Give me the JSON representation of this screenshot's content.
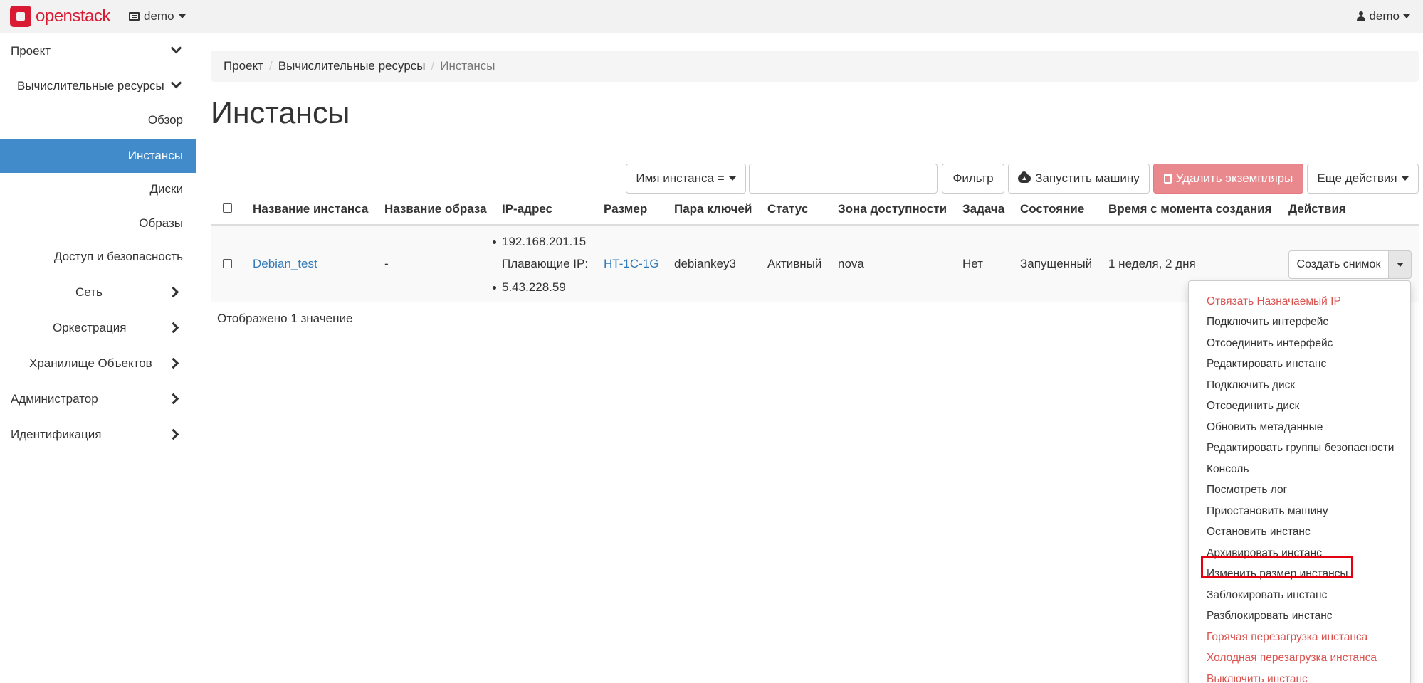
{
  "navbar": {
    "brand": "openstack",
    "project": "demo",
    "user": "demo"
  },
  "sidebar": {
    "items": [
      {
        "label": "Проект",
        "level": 0,
        "chevron": "down"
      },
      {
        "label": "Вычислительные ресурсы",
        "level": 1,
        "chevron": "down"
      },
      {
        "label": "Обзор",
        "level": 2
      },
      {
        "label": "Инстансы",
        "level": 2,
        "active": true
      },
      {
        "label": "Диски",
        "level": 2
      },
      {
        "label": "Образы",
        "level": 2
      },
      {
        "label": "Доступ и безопасность",
        "level": 2
      },
      {
        "label": "Сеть",
        "level": 1,
        "chevron": "right"
      },
      {
        "label": "Оркестрация",
        "level": 1,
        "chevron": "right"
      },
      {
        "label": "Хранилище Объектов",
        "level": 1,
        "chevron": "right"
      },
      {
        "label": "Администратор",
        "level": 0,
        "chevron": "right"
      },
      {
        "label": "Идентификация",
        "level": 0,
        "chevron": "right"
      }
    ]
  },
  "breadcrumb": [
    "Проект",
    "Вычислительные ресурсы",
    "Инстансы"
  ],
  "page_title": "Инстансы",
  "toolbar": {
    "filter_field": "Имя инстанса =",
    "filter_value": "",
    "filter_button": "Фильтр",
    "launch_button": "Запустить машину",
    "delete_button": "Удалить экземпляры",
    "more_button": "Еще действия"
  },
  "table": {
    "columns": [
      "Название инстанса",
      "Название образа",
      "IP-адрес",
      "Размер",
      "Пара ключей",
      "Статус",
      "Зона доступности",
      "Задача",
      "Состояние",
      "Время с момента создания",
      "Действия"
    ],
    "rows": [
      {
        "name": "Debian_test",
        "image": "-",
        "ip_fixed": "192.168.201.15",
        "ip_floating_label": "Плавающие IP:",
        "ip_floating": "5.43.228.59",
        "flavor": "HT-1C-1G",
        "keypair": "debiankey3",
        "status": "Активный",
        "zone": "nova",
        "task": "Нет",
        "power_state": "Запущенный",
        "age": "1 неделя, 2 дня",
        "action": "Создать снимок"
      }
    ],
    "footer": "Отображено 1 значение"
  },
  "dropdown": {
    "items": [
      {
        "label": "Отвязать Назначаемый IP",
        "danger": true
      },
      {
        "label": "Подключить интерфейс"
      },
      {
        "label": "Отсоединить интерфейс"
      },
      {
        "label": "Редактировать инстанс"
      },
      {
        "label": "Подключить диск"
      },
      {
        "label": "Отсоединить диск"
      },
      {
        "label": "Обновить метаданные"
      },
      {
        "label": "Редактировать группы безопасности"
      },
      {
        "label": "Консоль"
      },
      {
        "label": "Посмотреть лог"
      },
      {
        "label": "Приостановить машину"
      },
      {
        "label": "Остановить инстанс"
      },
      {
        "label": "Архивировать инстанс"
      },
      {
        "label": "Изменить размер инстансы",
        "highlighted": true
      },
      {
        "label": "Заблокировать инстанс"
      },
      {
        "label": "Разблокировать инстанс"
      },
      {
        "label": "Горячая перезагрузка инстанса",
        "danger": true
      },
      {
        "label": "Холодная перезагрузка инстанса",
        "danger": true
      },
      {
        "label": "Выключить инстанс",
        "danger": true
      }
    ]
  },
  "colors": {
    "accent": "#428bca",
    "link": "#337ab7",
    "danger": "#d9534f",
    "brand": "#da1a32",
    "highlight": "#e3000f"
  }
}
